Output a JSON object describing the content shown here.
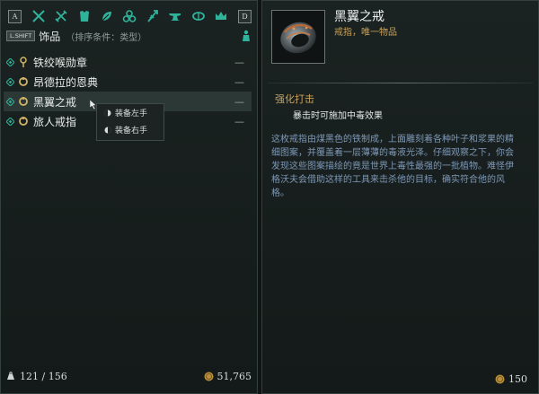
{
  "category_bar": {
    "left_key": "A",
    "right_key": "D",
    "icons": [
      "swords-icon",
      "crossed-weapons-icon",
      "armor-icon",
      "leaf-icon",
      "triple-orb-icon",
      "quiver-icon",
      "anvil-icon",
      "amulet-icon",
      "crown-icon"
    ]
  },
  "sort_bar": {
    "key_hint": "L.SHIFT",
    "category_title": "饰品",
    "sort_text": "（排序条件：类型）"
  },
  "items": [
    {
      "name": "铁绞喉勋章",
      "type_icon": "amulet-icon",
      "dash": "—"
    },
    {
      "name": "昂德拉的恩典",
      "type_icon": "ring-icon",
      "dash": "—"
    },
    {
      "name": "黑翼之戒",
      "type_icon": "ring-icon",
      "dash": "—",
      "selected": true
    },
    {
      "name": "旅人戒指",
      "type_icon": "ring-icon",
      "dash": "—"
    }
  ],
  "context_menu": {
    "equip_left": "装备左手",
    "equip_right": "装备右手"
  },
  "footer": {
    "weight": "121 / 156",
    "gold": "51,765"
  },
  "details": {
    "name": "黑翼之戒",
    "subtitle": "戒指，唯一物品",
    "enchant_title": "强化打击",
    "enchant_desc": "暴击时可施加中毒效果",
    "lore": "这枚戒指由煤黑色的铁制成，上面雕刻着各种叶子和浆果的精细图案，并覆盖着一层薄薄的毒液光泽。仔细观察之下，你会发现这些图案描绘的竟是世界上毒性最强的一批植物。难怪伊格沃夫会借助这样的工具来击杀他的目标，确实符合他的风格。",
    "price": "150"
  },
  "colors": {
    "accent_teal": "#2fb39a",
    "gold_text": "#c8a15a",
    "lore_text": "#7f98b6"
  }
}
